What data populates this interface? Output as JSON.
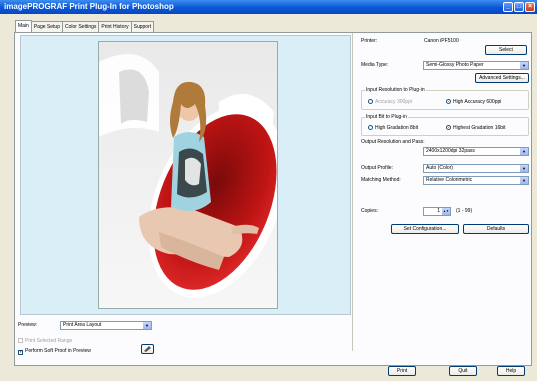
{
  "window": {
    "title": "imagePROGRAF Print Plug-In for Photoshop"
  },
  "tabs": [
    {
      "label": "Main",
      "active": true
    },
    {
      "label": "Page Setup",
      "active": false
    },
    {
      "label": "Color Settings",
      "active": false
    },
    {
      "label": "Print History",
      "active": false
    },
    {
      "label": "Support",
      "active": false
    }
  ],
  "printer": {
    "label": "Printer:",
    "value": "Canon iPF5100",
    "select_button": "Select"
  },
  "media_type": {
    "label": "Media Type:",
    "value": "Semi-Glossy Photo Paper",
    "advanced_button": "Advanced Settings..."
  },
  "input_resolution": {
    "title": "Input Resolution to Plug-in",
    "options": [
      {
        "label": "Accuracy 300ppi",
        "selected": false,
        "disabled": true
      },
      {
        "label": "High Accuracy 600ppi",
        "selected": true,
        "disabled": false
      }
    ]
  },
  "input_bit": {
    "title": "Input Bit to Plug-in",
    "options": [
      {
        "label": "High Gradation 8bit",
        "selected": false
      },
      {
        "label": "Highest Gradation 16bit",
        "selected": true
      }
    ]
  },
  "output_resolution": {
    "label": "Output Resolution and Pass:",
    "value": "2400x1200dpi 32pass"
  },
  "output_profile": {
    "label": "Output Profile:",
    "value": "Auto (Color)"
  },
  "matching_method": {
    "label": "Matching Method:",
    "value": "Relative Colorimetric"
  },
  "copies": {
    "label": "Copies:",
    "value": "1",
    "range": "(1 - 99)"
  },
  "buttons": {
    "set_configuration": "Set Configuration...",
    "defaults": "Defaults",
    "print": "Print",
    "quit": "Quit",
    "help": "Help"
  },
  "preview": {
    "label": "Preview:",
    "value": "Print Area Layout",
    "print_selected_range": "Print Selected Range",
    "perform_soft_proof": "Perform Soft Proof in Preview"
  },
  "colors": {
    "title_bar": "#0a56d8",
    "accent_green": "#8dc63f",
    "chair_red": "#d11f1f"
  }
}
